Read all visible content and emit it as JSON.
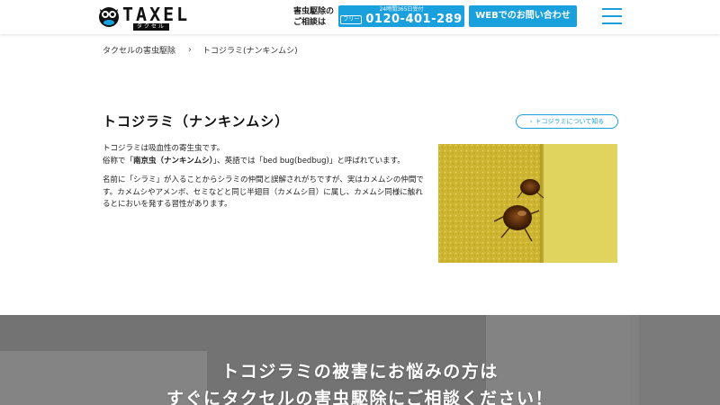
{
  "header": {
    "logo_text": "TAXEL",
    "logo_sub": "タクセル",
    "consult_label": "害虫駆除のご相談は",
    "phone_hours": "24時間365日受付",
    "phone_icon": "フリー",
    "phone_number": "0120-401-289",
    "web_contact": "WEBでのお問い合わせ",
    "colors": {
      "accent": "#1aa0dc"
    }
  },
  "breadcrumb": {
    "home": "タクセルの害虫駆除",
    "current": "トコジラミ(ナンキンムシ)"
  },
  "main": {
    "title": "トコジラミ（ナンキンムシ）",
    "about_link": "トコジラミについて知る",
    "para1_line1": "トコジラミは吸血性の寄生虫です。",
    "para1_pre": "俗称で「",
    "para1_bold": "南京虫（ナンキンムシ）",
    "para1_post": "」、英語では「bed bug(bedbug)」と呼ばれています。",
    "para2": "名前に「シラミ」が入ることからシラミの仲間と誤解されがちですが、実はカメムシの仲間です。カメムシやアメンボ、セミなどと同じ半翅目（カメムシ目）に属し、カメムシ同様に触れるとにおいを発する習性があります。"
  },
  "banner": {
    "line1": "トコジラミの被害にお悩みの方は",
    "line2": "すぐにタクセルの害虫駆除にご相談ください！"
  }
}
